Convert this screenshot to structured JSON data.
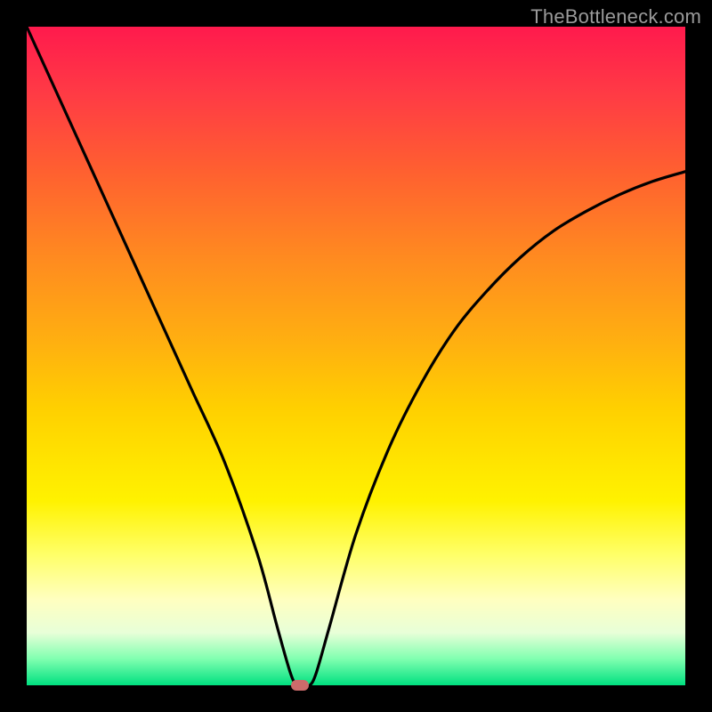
{
  "watermark": "TheBottleneck.com",
  "colors": {
    "curve": "#000000",
    "marker": "#cc6b6b",
    "frame": "#000000"
  },
  "chart_data": {
    "type": "line",
    "title": "",
    "xlabel": "",
    "ylabel": "",
    "xlim": [
      0,
      100
    ],
    "ylim": [
      0,
      100
    ],
    "grid": false,
    "legend": false,
    "series": [
      {
        "name": "curve",
        "x": [
          0,
          5,
          10,
          15,
          20,
          25,
          30,
          35,
          38,
          40,
          41,
          42,
          43,
          44,
          46,
          50,
          55,
          60,
          65,
          70,
          75,
          80,
          85,
          90,
          95,
          100
        ],
        "y": [
          100,
          89,
          78,
          67,
          56,
          45,
          34,
          20,
          9,
          2,
          0,
          0,
          0,
          2,
          9,
          23,
          36,
          46,
          54,
          60,
          65,
          69,
          72,
          74.5,
          76.5,
          78
        ]
      }
    ],
    "marker": {
      "x": 41.5,
      "y": 0
    },
    "gradient_stops": [
      {
        "pos": 0.0,
        "color": "#ff1a4d"
      },
      {
        "pos": 0.35,
        "color": "#ff8a20"
      },
      {
        "pos": 0.66,
        "color": "#ffe400"
      },
      {
        "pos": 0.87,
        "color": "#ffffc0"
      },
      {
        "pos": 1.0,
        "color": "#00e080"
      }
    ]
  }
}
